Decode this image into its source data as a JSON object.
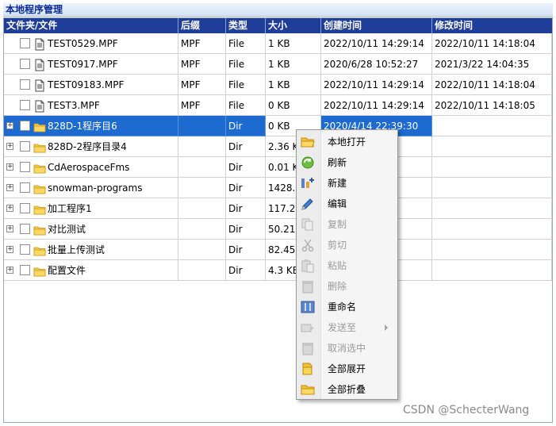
{
  "panel": {
    "title": "本地程序管理"
  },
  "columns": [
    "文件夹/文件",
    "后缀",
    "类型",
    "大小",
    "创建时间",
    "修改时间"
  ],
  "rows": [
    {
      "kind": "file",
      "name": "TEST0529.MPF",
      "ext": "MPF",
      "type": "File",
      "size": "1 KB",
      "created": "2022/10/11 14:29:14",
      "modified": "2022/10/11 14:18:04"
    },
    {
      "kind": "file",
      "name": "TEST0917.MPF",
      "ext": "MPF",
      "type": "File",
      "size": "1 KB",
      "created": "2020/6/28 10:52:27",
      "modified": "2021/3/22 14:04:35"
    },
    {
      "kind": "file",
      "name": "TEST09183.MPF",
      "ext": "MPF",
      "type": "File",
      "size": "1 KB",
      "created": "2022/10/11 14:29:14",
      "modified": "2022/10/11 14:18:04"
    },
    {
      "kind": "file",
      "name": "TEST3.MPF",
      "ext": "MPF",
      "type": "File",
      "size": "0 KB",
      "created": "2022/10/11 14:29:14",
      "modified": "2022/10/11 14:18:05"
    },
    {
      "kind": "dir",
      "name": "828D-1程序目6",
      "ext": "",
      "type": "Dir",
      "size": "0 KB",
      "created": "2020/4/14 22:39:30",
      "modified": "",
      "selected": true
    },
    {
      "kind": "dir",
      "name": "828D-2程序目录4",
      "ext": "",
      "type": "Dir",
      "size": "2.36 K",
      "created": "30",
      "modified": ""
    },
    {
      "kind": "dir",
      "name": "CdAerospaceFms",
      "ext": "",
      "type": "Dir",
      "size": "0.01 K",
      "created": "16",
      "modified": ""
    },
    {
      "kind": "dir",
      "name": "snowman-programs",
      "ext": "",
      "type": "Dir",
      "size": "1428.0",
      "created": "30",
      "modified": ""
    },
    {
      "kind": "dir",
      "name": "加工程序1",
      "ext": "",
      "type": "Dir",
      "size": "117.26",
      "created": "31",
      "modified": ""
    },
    {
      "kind": "dir",
      "name": "对比测试",
      "ext": "",
      "type": "Dir",
      "size": "50.21 I",
      "created": "30",
      "modified": ""
    },
    {
      "kind": "dir",
      "name": "批量上传测试",
      "ext": "",
      "type": "Dir",
      "size": "82.45 I",
      "created": "31",
      "modified": ""
    },
    {
      "kind": "dir",
      "name": "配置文件",
      "ext": "",
      "type": "Dir",
      "size": "4.3 KB",
      "created": "31",
      "modified": ""
    }
  ],
  "context_menu": [
    {
      "label": "本地打开",
      "icon": "folder-open-icon",
      "enabled": true
    },
    {
      "label": "刷新",
      "icon": "refresh-icon",
      "enabled": true
    },
    {
      "label": "新建",
      "icon": "new-item-icon",
      "enabled": true
    },
    {
      "label": "编辑",
      "icon": "pencil-icon",
      "enabled": true
    },
    {
      "label": "复制",
      "icon": "copy-icon",
      "enabled": false
    },
    {
      "label": "剪切",
      "icon": "scissors-icon",
      "enabled": false
    },
    {
      "label": "粘贴",
      "icon": "paste-icon",
      "enabled": false
    },
    {
      "label": "删除",
      "icon": "trash-icon",
      "enabled": false
    },
    {
      "label": "重命名",
      "icon": "rename-icon",
      "enabled": true
    },
    {
      "label": "发送至",
      "icon": "send-icon",
      "enabled": false,
      "submenu": true
    },
    {
      "label": "取消选中",
      "icon": "deselect-icon",
      "enabled": false
    },
    {
      "label": "全部展开",
      "icon": "expand-all-icon",
      "enabled": true
    },
    {
      "label": "全部折叠",
      "icon": "collapse-all-icon",
      "enabled": true
    }
  ],
  "watermark": "CSDN @SchecterWang",
  "colors": {
    "header_bg": "#1f3e99",
    "selection": "#1d6ad1",
    "title_text": "#0b2a9a"
  }
}
